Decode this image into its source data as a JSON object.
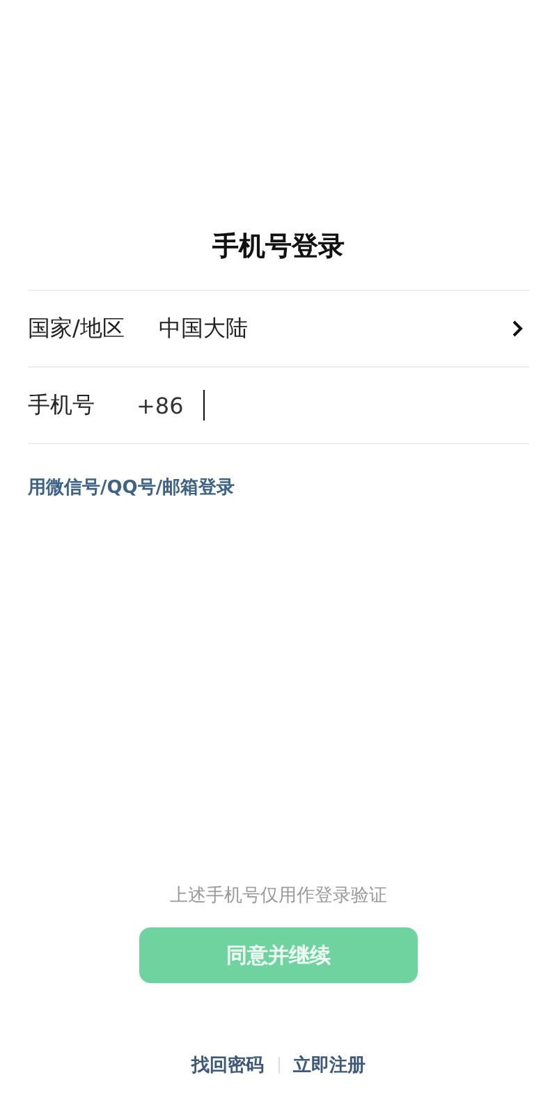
{
  "title": "手机号登录",
  "fields": [
    {
      "kind": "select",
      "label": "国家/地区",
      "value": "中国大陆"
    },
    {
      "kind": "phone",
      "label": "手机号",
      "prefix": "+86",
      "focused": true
    }
  ],
  "alt_login_link": "用微信号/QQ号/邮箱登录",
  "hint": "上述手机号仅用作登录验证",
  "continue_button": {
    "label": "同意并继续",
    "disabled": true
  },
  "footer_links": [
    "找回密码",
    "立即注册"
  ]
}
